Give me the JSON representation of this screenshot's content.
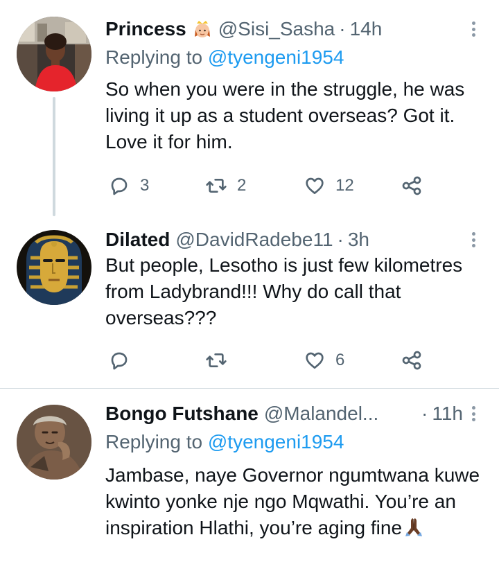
{
  "tweets": [
    {
      "name": "Princess",
      "emoji": "princess-emoji",
      "handle": "@Sisi_Sasha",
      "separator": "·",
      "time": "14h",
      "replying_prefix": "Replying to",
      "replying_to": "@tyengeni1954",
      "text": "So when you were in the struggle, he was living it up as a student overseas? Got it. Love it for him.",
      "replies": "3",
      "retweets": "2",
      "likes": "12",
      "icons": [
        "reply-icon",
        "retweet-icon",
        "like-icon",
        "share-icon"
      ]
    },
    {
      "name": "Dilated",
      "handle": "@DavidRadebe11",
      "separator": "·",
      "time": "3h",
      "text": "But people, Lesotho is just few kilometres from Ladybrand!!! Why do call that overseas???",
      "replies": "",
      "retweets": "",
      "likes": "6",
      "icons": [
        "reply-icon",
        "retweet-icon",
        "like-icon",
        "share-icon"
      ]
    },
    {
      "name": "Bongo Futshane",
      "handle": "@Malandel...",
      "separator": "·",
      "time": "11h",
      "replying_prefix": "Replying to",
      "replying_to": "@tyengeni1954",
      "text": "Jambase, naye Governor ngumtwana kuwe kwinto yonke nje ngo Mqwathi. You’re an inspiration Hlathi, you’re aging fine",
      "trailing_emoji": "praying-hands-emoji"
    }
  ],
  "colors": {
    "text_primary": "#0f1419",
    "text_secondary": "#536471",
    "link": "#1d9bf0",
    "divider": "#d5dde2",
    "thread_line": "#cfd9de"
  }
}
